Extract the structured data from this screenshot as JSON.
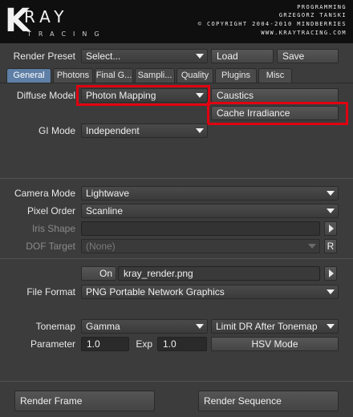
{
  "header": {
    "logo_k": "K",
    "logo_word": "RAY",
    "logo_sub": "TRACING",
    "credit_lines": [
      "PROGRAMMING",
      "GRZEGORZ TANSKI",
      "© COPYRIGHT 2004-2010 MINDBERRIES",
      "WWW.KRAYTRACING.COM"
    ]
  },
  "preset": {
    "label": "Render Preset",
    "value": "Select...",
    "load": "Load",
    "save": "Save"
  },
  "tabs": [
    {
      "label": "General",
      "active": true
    },
    {
      "label": "Photons"
    },
    {
      "label": "Final G..."
    },
    {
      "label": "Sampli..."
    },
    {
      "label": "Quality"
    },
    {
      "label": "Plugins"
    },
    {
      "label": "Misc"
    }
  ],
  "general": {
    "diffuse_label": "Diffuse Model",
    "diffuse_value": "Photon Mapping",
    "caustics": "Caustics",
    "cache_irradiance": "Cache Irradiance",
    "gi_label": "GI Mode",
    "gi_value": "Independent"
  },
  "camera": {
    "camera_mode_label": "Camera Mode",
    "camera_mode_value": "Lightwave",
    "pixel_order_label": "Pixel Order",
    "pixel_order_value": "Scanline",
    "iris_label": "Iris Shape",
    "iris_value": "",
    "dof_label": "DOF Target",
    "dof_value": "(None)",
    "dof_button": "R"
  },
  "output": {
    "on_label": "On",
    "filename": "kray_render.png",
    "format_label": "File Format",
    "format_value": "PNG Portable Network Graphics"
  },
  "tonemap": {
    "label": "Tonemap",
    "value": "Gamma",
    "limit_value": "Limit DR After Tonemap",
    "parameter_label": "Parameter",
    "parameter_value": "1.0",
    "exp_label": "Exp",
    "exp_value": "1.0",
    "hsv_button": "HSV Mode"
  },
  "footer": {
    "render_frame": "Render Frame",
    "render_sequence": "Render Sequence"
  },
  "colors": {
    "active_tab": "#5e7fa6",
    "highlight": "#e00010",
    "background": "#3c3c3c"
  }
}
